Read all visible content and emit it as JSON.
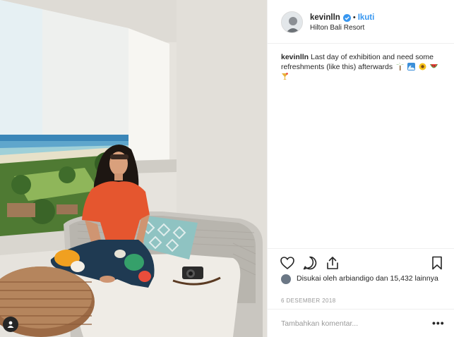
{
  "post": {
    "username": "kevinlln",
    "follow_label": "Ikuti",
    "separator": "•",
    "location": "Hilton Bali Resort",
    "caption": {
      "username": "kevinlln",
      "text": "Last day of exhibition and need some refreshments (like this) afterwards",
      "emojis": [
        "palm-tree-emoji",
        "wave-emoji",
        "sunflower-emoji",
        "watermelon-emoji",
        "cocktail-emoji"
      ]
    },
    "likes_text": "Disukai oleh arbiandigo dan 15,432 lainnya",
    "date": "6 DESEMBER 2018",
    "comment_placeholder": "Tambahkan komentar...",
    "more_label": "•••"
  },
  "colors": {
    "accent_blue": "#3897f0",
    "text": "#262626",
    "muted": "#999999",
    "divider": "#efefef"
  },
  "icons": [
    "heart-icon",
    "comment-icon",
    "share-icon",
    "bookmark-icon",
    "verified-badge-icon",
    "profile-icon"
  ]
}
